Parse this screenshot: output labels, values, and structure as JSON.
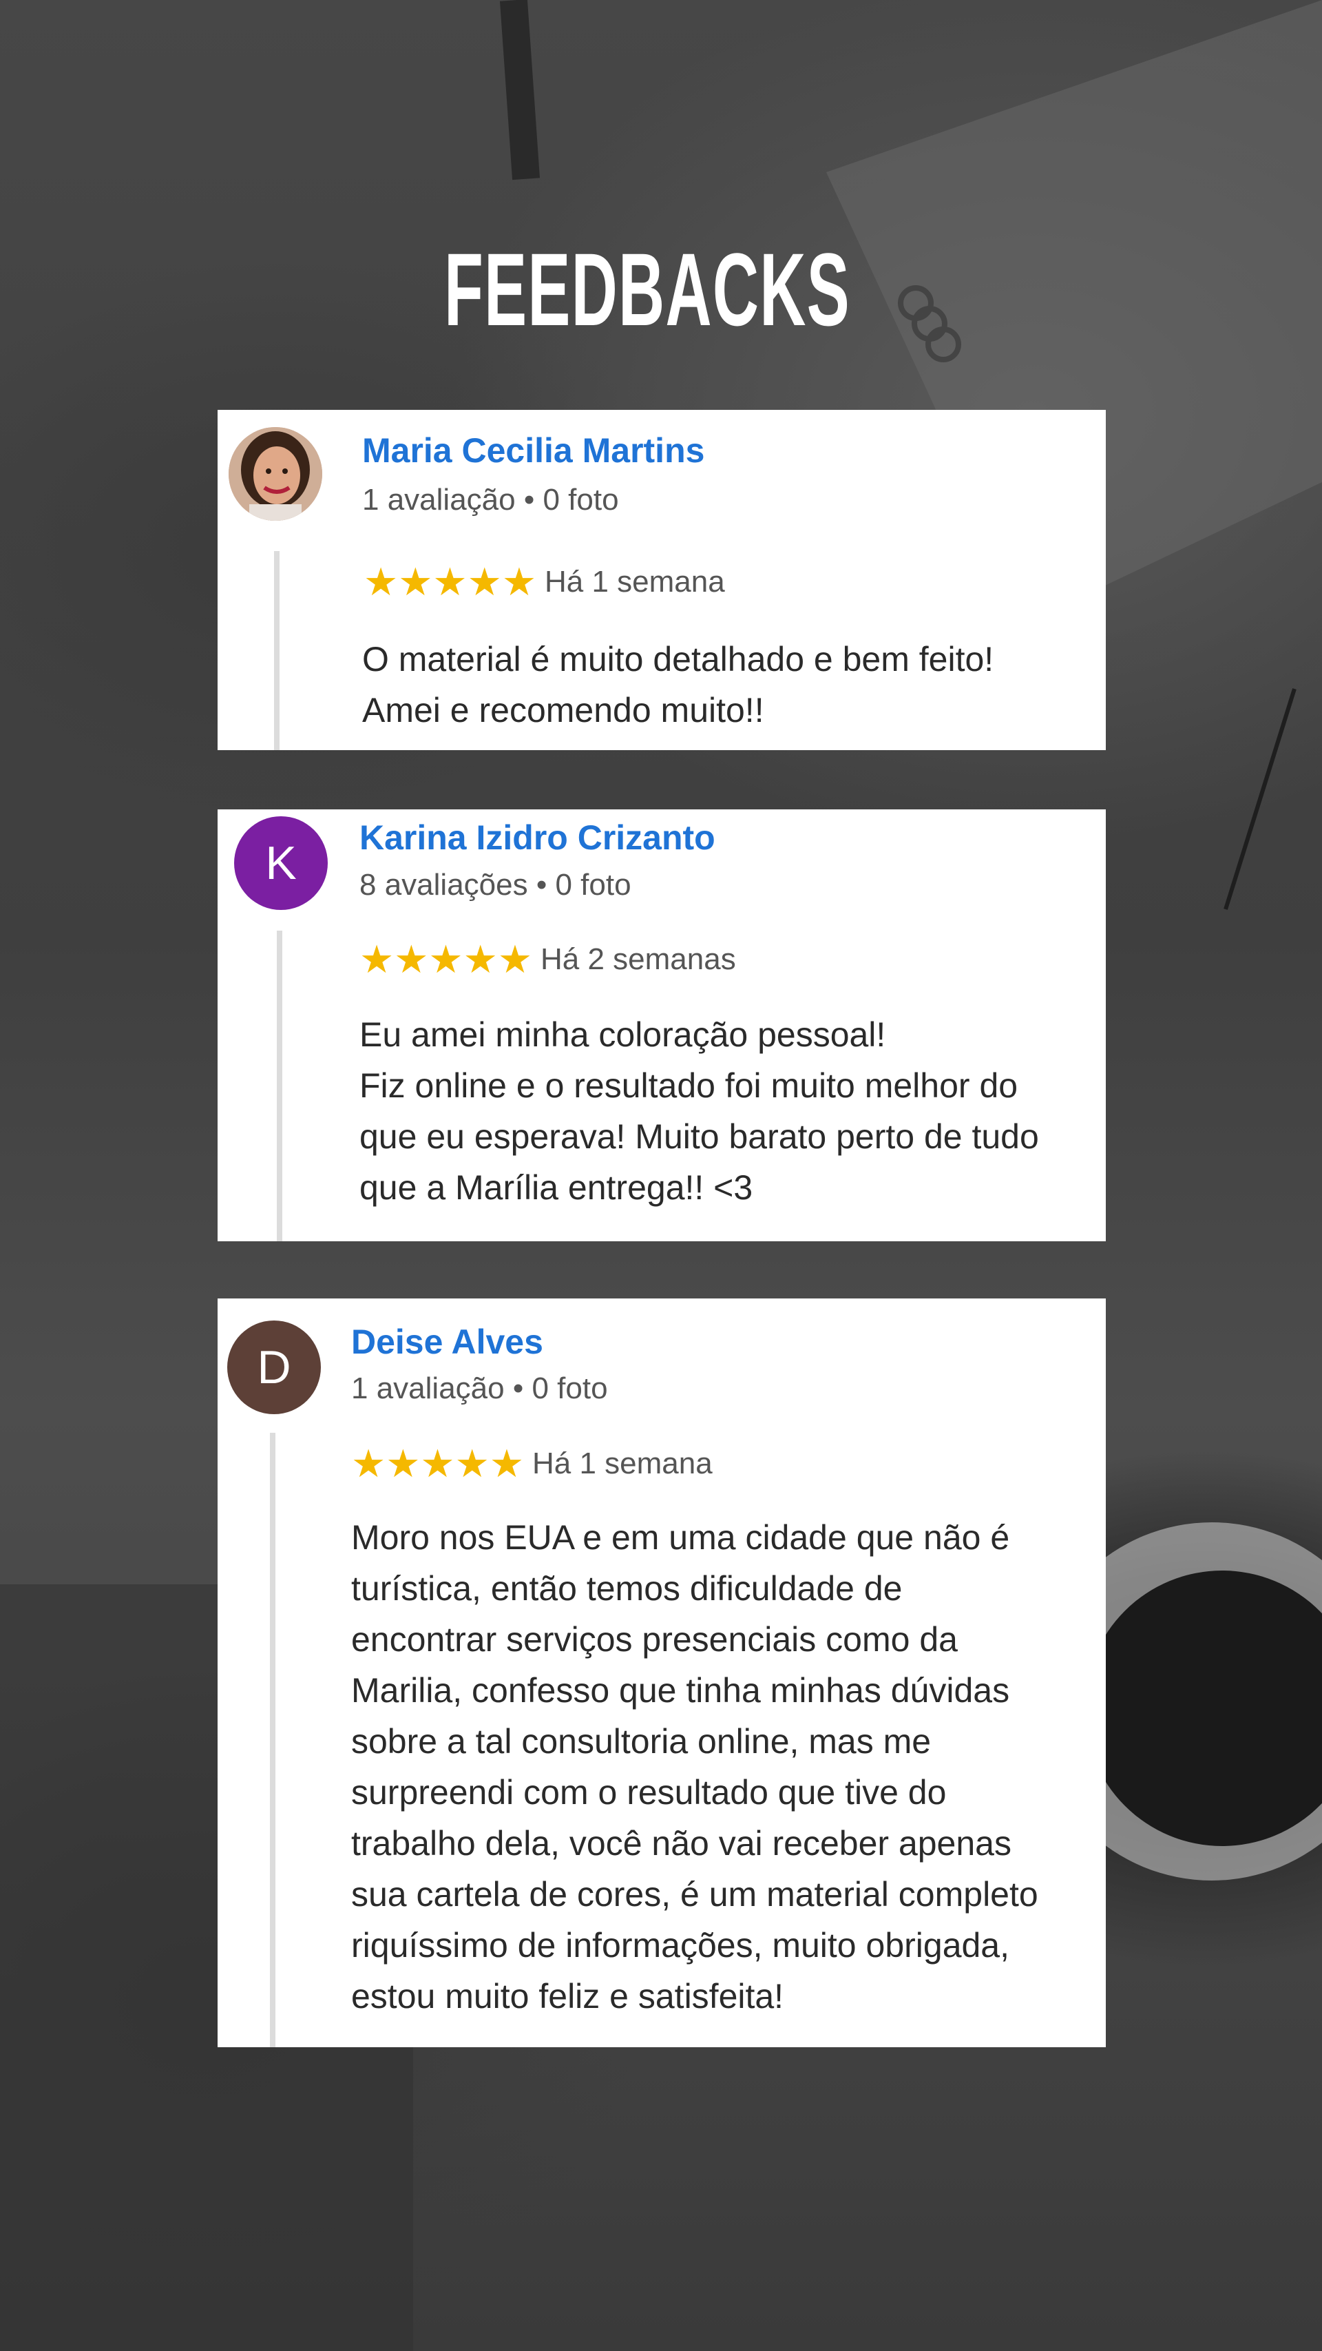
{
  "title": "FEEDBACKS",
  "colors": {
    "name": "#1f73d6",
    "star": "#f5b800",
    "avatar_purple": "#7b1fa2",
    "avatar_brown": "#5d4037"
  },
  "reviews": [
    {
      "name": "Maria Cecilia Martins",
      "meta": "1 avaliação • 0 foto",
      "avatar": "profile-photo",
      "rating": 5,
      "stars": "★★★★★",
      "time": "Há 1 semana",
      "text": "O material é muito detalhado e bem feito!\nAmei e recomendo muito!!"
    },
    {
      "name": "Karina Izidro Crizanto",
      "meta": "8 avaliações • 0 foto",
      "avatar_letter": "K",
      "rating": 5,
      "stars": "★★★★★",
      "time": "Há 2 semanas",
      "text": "Eu amei minha coloração pessoal!\nFiz online e o resultado foi muito melhor do\nque eu esperava! Muito barato perto de tudo\nque a Marília entrega!! <3"
    },
    {
      "name": "Deise Alves",
      "meta": "1 avaliação • 0 foto",
      "avatar_letter": "D",
      "rating": 5,
      "stars": "★★★★★",
      "time": "Há 1 semana",
      "text": "Moro nos EUA e em uma cidade que não é\nturística, então temos dificuldade de\nencontrar serviços presenciais como da\nMarilia, confesso que tinha minhas dúvidas\nsobre a tal consultoria online, mas me\nsurpreendi com o resultado que tive do\ntrabalho dela, você não vai receber apenas\nsua cartela de cores, é um material completo\nriquíssimo de informações, muito obrigada,\nestou muito feliz e satisfeita!"
    }
  ]
}
